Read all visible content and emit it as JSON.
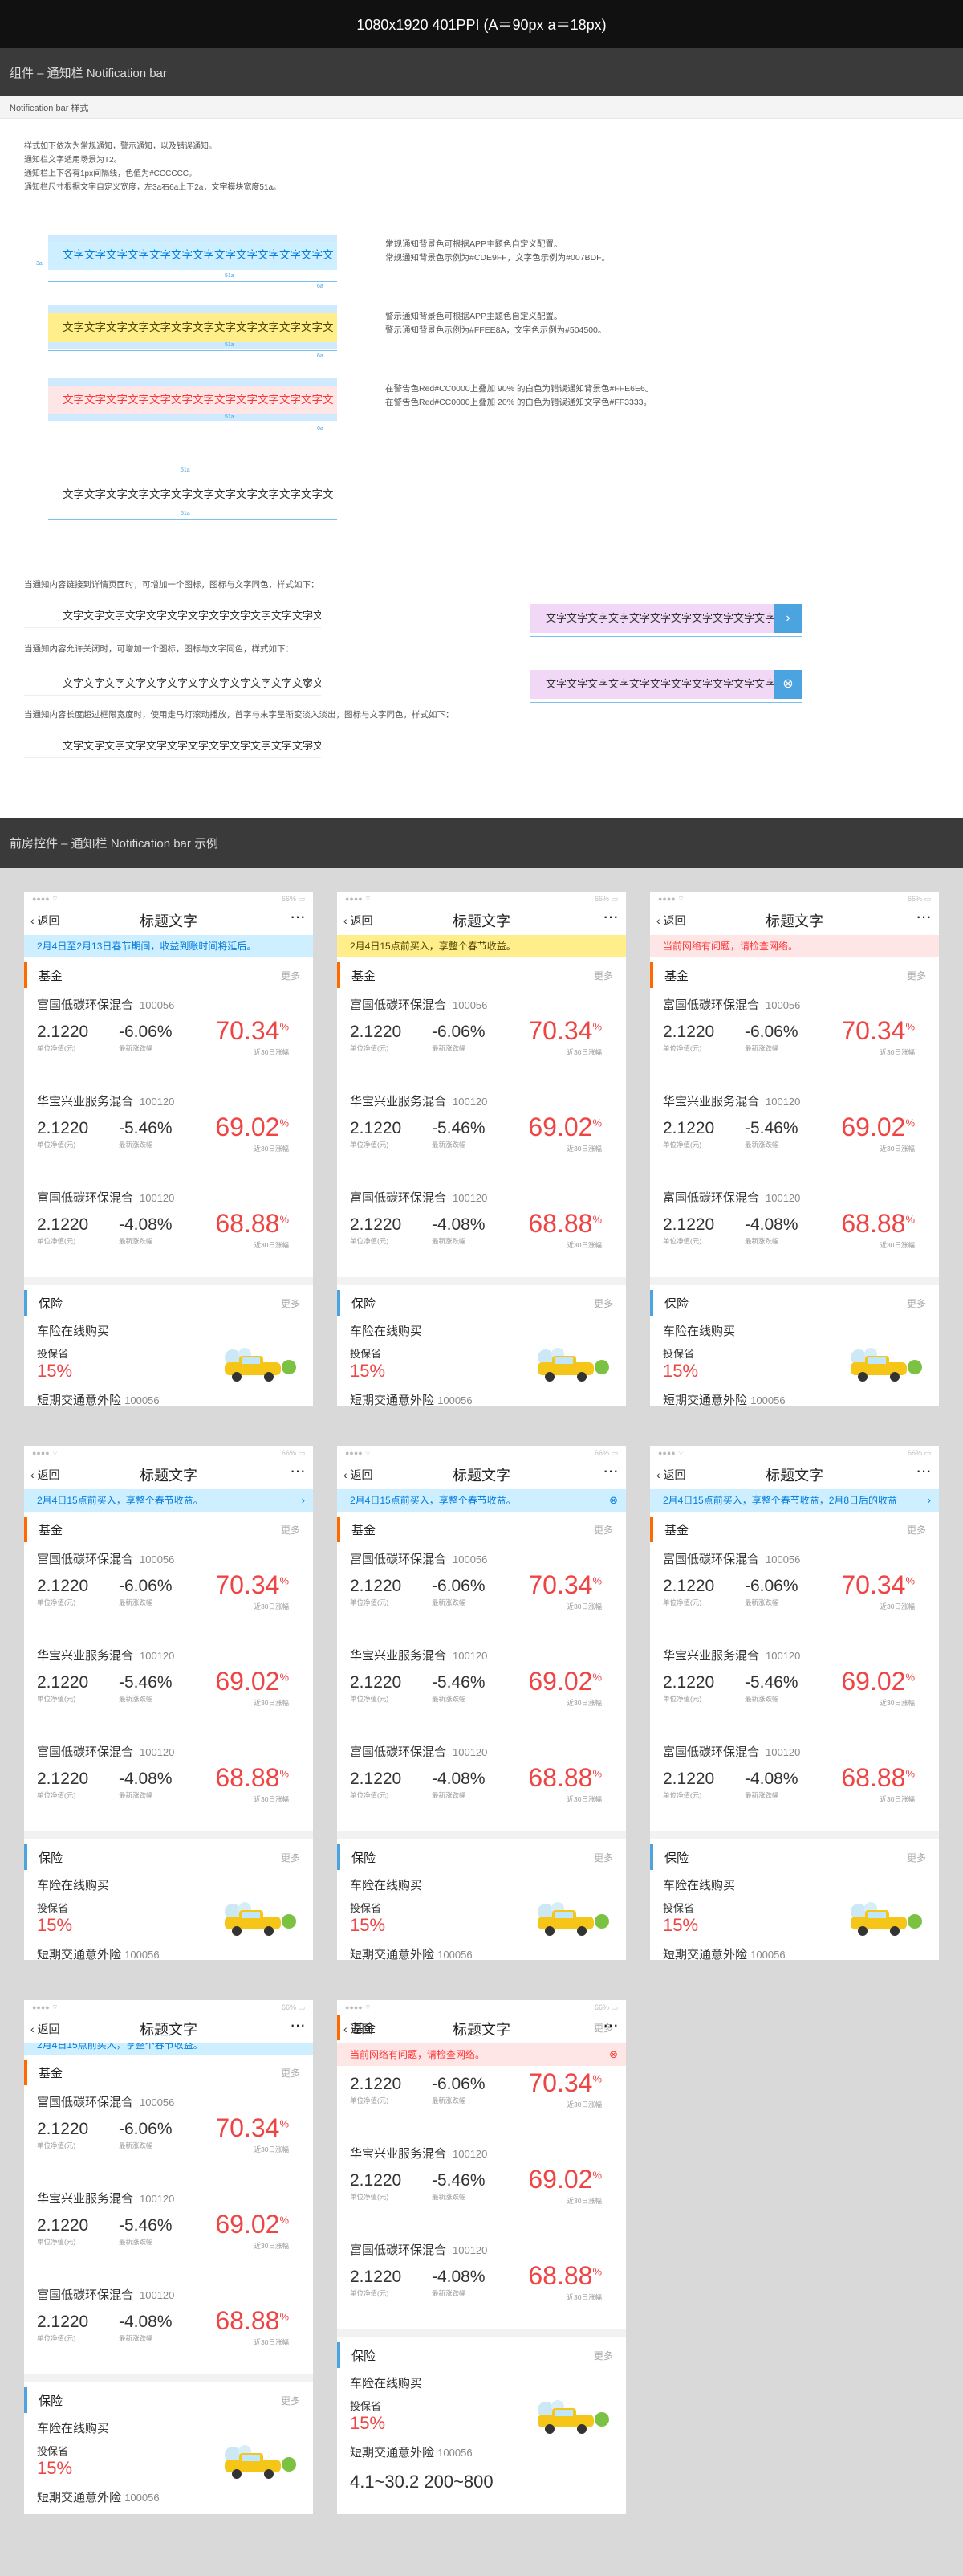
{
  "header": {
    "title": "1080x1920 401PPI (A＝90px a＝18px)"
  },
  "section1": {
    "title": "组件 – 通知栏 Notification bar",
    "subtitle": "Notification bar 样式"
  },
  "intro": [
    "样式如下依次为常规通知，警示通知，以及错误通知。",
    "通知栏文字适用场景为T2。",
    "通知栏上下各有1px间隔线，色值为#CCCCCC。",
    "通知栏尺寸根据文字自定义宽度，左3a右6a上下2a，文字模块宽度51a。"
  ],
  "sample_text": "文字文字文字文字文字文字文字文字文字文字文字文字文",
  "spec_notes": {
    "blue": [
      "常规通知背景色可根据APP主题色自定义配置。",
      "常规通知背景色示例为#CDE9FF，文字色示例为#007BDF。"
    ],
    "yellow": [
      "警示通知背景色可根据APP主题色自定义配置。",
      "警示通知背景色示例为#FFEE8A，文字色示例为#504500。"
    ],
    "red": [
      "在警告色Red#CC0000上叠加 90% 的白色为错误通知背景色#FFE6E6。",
      "在警告色Red#CC0000上叠加 20% 的白色为错误通知文字色#FF3333。"
    ]
  },
  "desc": {
    "link": "当通知内容链接到详情页面时，可增加一个图标，图标与文字同色，样式如下：",
    "close": "当通知内容允许关闭时，可增加一个图标，图标与文字同色，样式如下：",
    "marquee": "当通知内容长度超过框限宽度时，使用走马灯滚动播放，首字与末字呈渐变淡入淡出，图标与文字同色，样式如下："
  },
  "measures": {
    "a": "3a",
    "b": "51a",
    "c": "6a",
    "d": "2a"
  },
  "section2": {
    "title": "前房控件 – 通知栏 Notification bar 示例"
  },
  "phone": {
    "status_left": "●●●●  ⌔",
    "status_right": "66% ▭",
    "back": "返回",
    "title": "标题文字",
    "more": "···",
    "fund_section": "基金",
    "more_label": "更多",
    "insurance_section": "保险",
    "funds": [
      {
        "name": "富国低碳环保混合",
        "code": "100056",
        "nav": "2.1220",
        "change": "-6.06%",
        "ret": "70.34",
        "pct": "%"
      },
      {
        "name": "华宝兴业服务混合",
        "code": "100120",
        "nav": "2.1220",
        "change": "-5.46%",
        "ret": "69.02",
        "pct": "%"
      },
      {
        "name": "富国低碳环保混合",
        "code": "100120",
        "nav": "2.1220",
        "change": "-4.08%",
        "ret": "68.88",
        "pct": "%"
      }
    ],
    "labels": {
      "nav": "单位净值(元)",
      "change": "最新涨跌幅",
      "ret": "近30日涨幅"
    },
    "insurance": {
      "name": "车险在线购买",
      "sub": "投保省",
      "pct": "15%"
    },
    "insurance2": {
      "name": "短期交通意外险",
      "code": "100056",
      "range": "4.1~30.2",
      "range2": "200~800"
    }
  },
  "notices": {
    "n1": "2月4日至2月13日春节期间，收益到账时间将延后。",
    "n2": "2月4日15点前买入，享整个春节收益。",
    "n3": "当前网络有问题，请检查网络。",
    "n4": "2月4日15点前买入，享整个春节收益。",
    "n5": "2月4日15点前买入，享整个春节收益。",
    "n6": "2月4日15点前买入，享整个春节收益，2月8日后的收益",
    "n7": "2月4日15点前买入，享整个春节收益。",
    "n8": "当前网络有问题，请检查网络。"
  },
  "colors": {
    "blue_bg": "#CDEFFF",
    "blue_fg": "#007BDF",
    "yellow_bg": "#FFEE8A",
    "yellow_fg": "#504500",
    "red_bg": "#FFE6E6",
    "red_fg": "#FF3333"
  },
  "icons": {
    "chevron": "chevron-right-icon",
    "close": "close-circle-icon"
  }
}
